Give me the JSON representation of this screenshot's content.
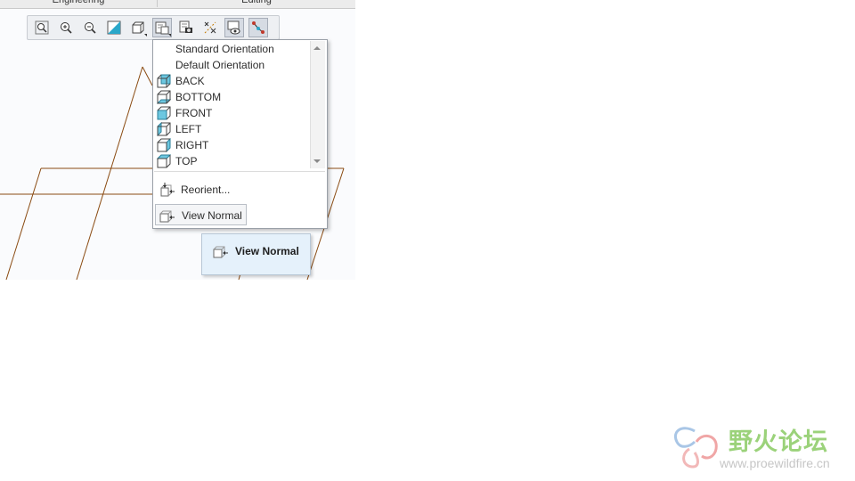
{
  "tabs": [
    "Engineering",
    "Editing"
  ],
  "toolbar": {
    "buttons": [
      {
        "name": "refit-icon",
        "active": false
      },
      {
        "name": "zoom-in-icon",
        "active": false
      },
      {
        "name": "zoom-out-icon",
        "active": false
      },
      {
        "name": "repaint-icon",
        "active": false
      },
      {
        "name": "display-style-icon",
        "active": false
      },
      {
        "name": "saved-orientations-icon",
        "active": true
      },
      {
        "name": "view-manager-icon",
        "active": false
      },
      {
        "name": "datum-display-icon",
        "active": false
      },
      {
        "name": "spin-center-icon",
        "active": false
      },
      {
        "name": "annotation-display-icon",
        "active": true
      }
    ]
  },
  "orientation_menu": {
    "items": [
      {
        "label": "Standard Orientation",
        "icon": ""
      },
      {
        "label": "Default Orientation",
        "icon": ""
      },
      {
        "label": "BACK",
        "icon": "cube-back-icon"
      },
      {
        "label": "BOTTOM",
        "icon": "cube-bottom-icon"
      },
      {
        "label": "FRONT",
        "icon": "cube-front-icon"
      },
      {
        "label": "LEFT",
        "icon": "cube-left-icon"
      },
      {
        "label": "RIGHT",
        "icon": "cube-right-icon"
      },
      {
        "label": "TOP",
        "icon": "cube-top-icon"
      }
    ],
    "reorient_label": "Reorient...",
    "view_normal_label": "View Normal"
  },
  "tooltip": {
    "label": "View Normal"
  },
  "watermark": {
    "text_cn": "野火论坛",
    "url": "www.proewildfire.cn"
  },
  "colors": {
    "wireframe": "#8a4b12",
    "accent": "#2aa7c9",
    "tooltip_bg": "#e5f1fb"
  }
}
